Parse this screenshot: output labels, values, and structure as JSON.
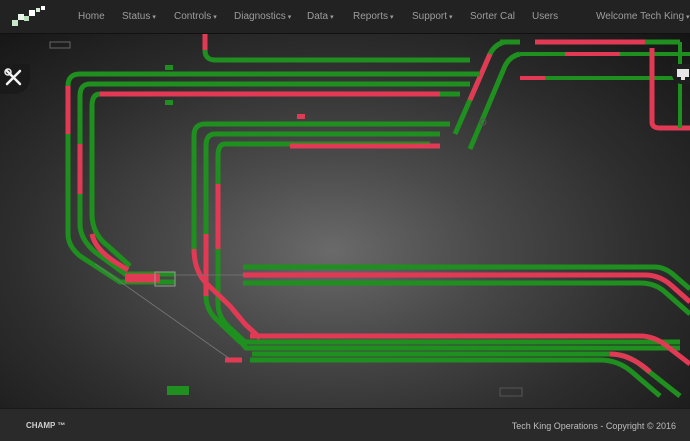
{
  "nav": {
    "home": "Home",
    "status": "Status",
    "controls": "Controls",
    "diagnostics": "Diagnostics",
    "data": "Data",
    "reports": "Reports",
    "support": "Support",
    "sorter_cal": "Sorter Cal",
    "users": "Users",
    "welcome": "Welcome Tech King"
  },
  "footer": {
    "brand": "CHAMP ™",
    "copyright": "Tech King Operations - Copyright © 2016"
  },
  "colors": {
    "track_green": "#1f8f1f",
    "track_red": "#e23a55",
    "navbar": "#222222",
    "accent_bell": "#f0a020"
  },
  "icons": {
    "tools": "wrench-screwdriver-icon",
    "panel": "monitor-icon",
    "bell": "bell-icon"
  }
}
